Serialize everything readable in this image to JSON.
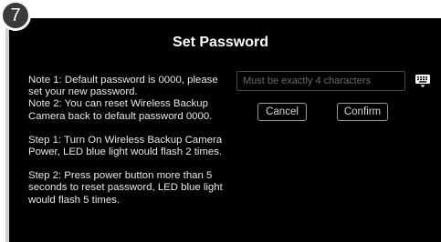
{
  "step_badge": "7",
  "dialog": {
    "title": "Set Password",
    "notes": [
      "Note 1: Default password is 0000, please\nset your new password.\nNote 2: You can reset Wireless Backup\nCamera back to default password 0000.",
      "Step 1: Turn On Wireless Backup Camera\nPower, LED blue light would flash 2 times.",
      "Step 2: Press power button more than 5\nseconds to reset password, LED blue light\nwould flash 5 times."
    ],
    "password_field": {
      "placeholder": "Must be exactly 4 characters",
      "value": ""
    },
    "keyboard_icon": "keyboard-hide-icon",
    "cancel_label": "Cancel",
    "confirm_label": "Confirm"
  }
}
